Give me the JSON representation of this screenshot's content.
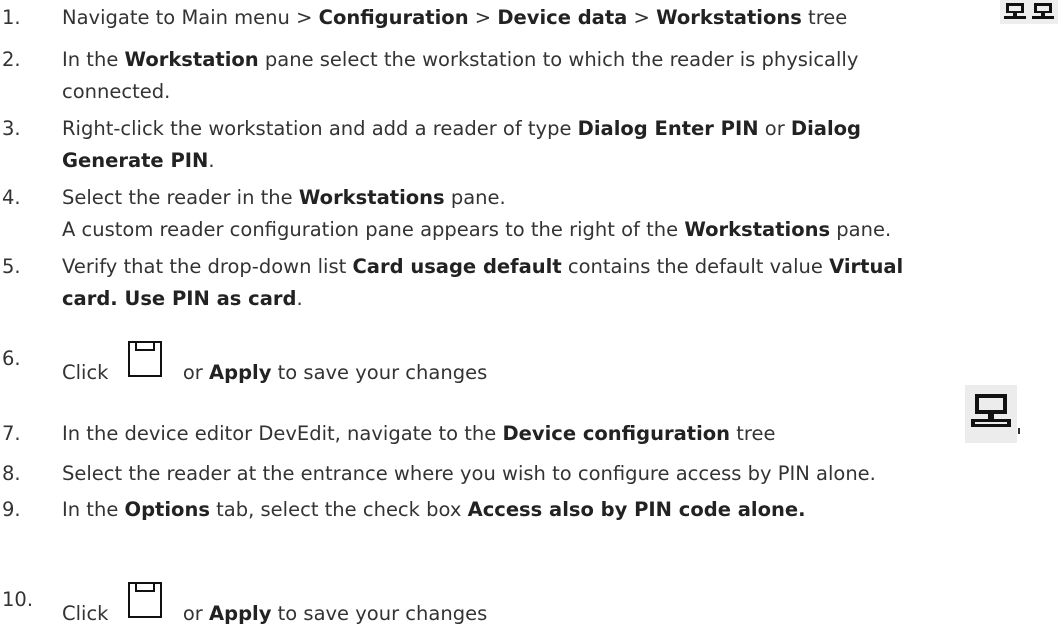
{
  "steps": [
    {
      "n": "1.",
      "p1": "Navigate to Main menu > ",
      "b1": "Configuration",
      "p2": " > ",
      "b2": "Device data",
      "p3": " > ",
      "b3": "Workstations",
      "p4": " tree "
    },
    {
      "n": "2.",
      "p1": "In the ",
      "b1": "Workstation",
      "p2": " pane select the workstation to which the reader is physically",
      "l2": "connected."
    },
    {
      "n": "3.",
      "p1": "Right-click the workstation and add a reader of type ",
      "b1": "Dialog Enter PIN",
      "p2": " or ",
      "b2": "Dialog",
      "l2b": "Generate PIN",
      "l2p": "."
    },
    {
      "n": "4.",
      "p1": "Select the reader in the ",
      "b1": "Workstations",
      "p2": " pane.",
      "l2": "A custom reader configuration pane appears to the right of the ",
      "l2b": "Workstations",
      "l2p": " pane."
    },
    {
      "n": "5.",
      "p1": "Verify that the drop-down list ",
      "b1": "Card usage default",
      "p2": " contains the default value ",
      "b2": "Virtual",
      "l2b": "card. Use PIN as card",
      "l2p": "."
    },
    {
      "n": "6.",
      "p1": "Click ",
      "p2": " or ",
      "b1": "Apply",
      "p3": " to save your changes"
    },
    {
      "n": "7.",
      "p1": "In the device editor DevEdit, navigate to the ",
      "b1": "Device configuration",
      "p2": " tree"
    },
    {
      "n": "8.",
      "p1": "Select the reader at the entrance where you wish to configure access by PIN alone."
    },
    {
      "n": "9.",
      "p1": "In the ",
      "b1": "Options",
      "p2": " tab, select the check box ",
      "b2": "Access also by PIN code alone."
    },
    {
      "n": "10.",
      "p1": "Click ",
      "p2": " or ",
      "b1": "Apply",
      "p3": " to save your changes"
    }
  ],
  "icons": {
    "workstations_tree": "workstations-tree-icon",
    "save": "save-icon",
    "device_configuration": "device-configuration-icon"
  },
  "colors": {
    "text": "#333333",
    "icon_bg": "#e8e8e8"
  }
}
